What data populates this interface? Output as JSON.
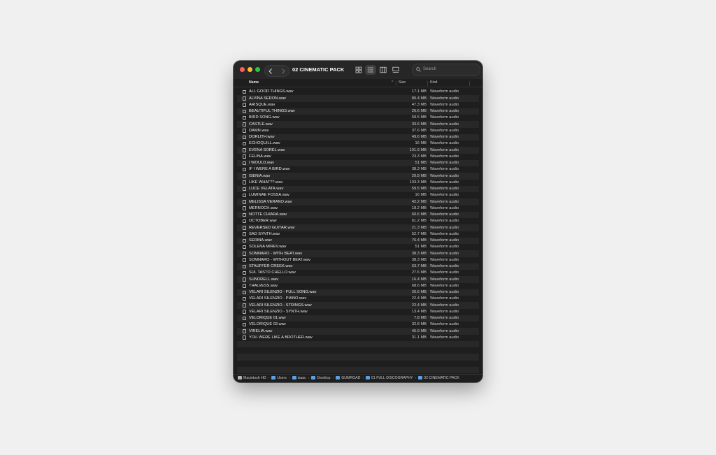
{
  "window": {
    "title": "02 CINEMATIC PACK",
    "search_placeholder": "Search"
  },
  "toolbar": {
    "back_icon": "chevron-left-icon",
    "forward_icon": "chevron-right-icon",
    "view_icons": [
      "icon-view-icon",
      "list-view-icon",
      "column-view-icon",
      "gallery-view-icon"
    ],
    "active_view": "list-view-icon"
  },
  "columns": {
    "name": "Name",
    "size": "Size",
    "kind": "Kind"
  },
  "files": [
    {
      "name": "ALL GOOD THINGS.wav",
      "size": "17.1 MB",
      "kind": "Waveform audio"
    },
    {
      "name": "ALVINA SERON.wav",
      "size": "80.4 MB",
      "kind": "Waveform audio"
    },
    {
      "name": "ARISQUE.wav",
      "size": "47.3 MB",
      "kind": "Waveform audio"
    },
    {
      "name": "BEAUTIFUL THINGS.wav",
      "size": "26.6 MB",
      "kind": "Waveform audio"
    },
    {
      "name": "BIRD SONG.wav",
      "size": "59.5 MB",
      "kind": "Waveform audio"
    },
    {
      "name": "CASTLE.wav",
      "size": "33.6 MB",
      "kind": "Waveform audio"
    },
    {
      "name": "DAMN.wav",
      "size": "37.6 MB",
      "kind": "Waveform audio"
    },
    {
      "name": "DORLITH.wav",
      "size": "49.6 MB",
      "kind": "Waveform audio"
    },
    {
      "name": "ECHOQUILL.wav",
      "size": "16 MB",
      "kind": "Waveform audio"
    },
    {
      "name": "EVENA SOREL.wav",
      "size": "101.9 MB",
      "kind": "Waveform audio"
    },
    {
      "name": "FELINA.wav",
      "size": "23.3 MB",
      "kind": "Waveform audio"
    },
    {
      "name": "I WOULD.wav",
      "size": "51 MB",
      "kind": "Waveform audio"
    },
    {
      "name": "IF I WERE A BIRD.wav",
      "size": "38.3 MB",
      "kind": "Waveform audio"
    },
    {
      "name": "ISENIA.wav",
      "size": "20.8 MB",
      "kind": "Waveform audio"
    },
    {
      "name": "LIKE WHAT??.wav",
      "size": "103.3 MB",
      "kind": "Waveform audio"
    },
    {
      "name": "LUCE VELATA.wav",
      "size": "59.5 MB",
      "kind": "Waveform audio"
    },
    {
      "name": "LUMINAE FOSSA.wav",
      "size": "16 MB",
      "kind": "Waveform audio"
    },
    {
      "name": "MELISSA VERANO.wav",
      "size": "42.2 MB",
      "kind": "Waveform audio"
    },
    {
      "name": "MERNOCH.wav",
      "size": "18.2 MB",
      "kind": "Waveform audio"
    },
    {
      "name": "NOTTE CHIARA.wav",
      "size": "60.6 MB",
      "kind": "Waveform audio"
    },
    {
      "name": "OCTOBER.wav",
      "size": "61.2 MB",
      "kind": "Waveform audio"
    },
    {
      "name": "REVERSED GUITAR.wav",
      "size": "21.3 MB",
      "kind": "Waveform audio"
    },
    {
      "name": "SAD SYNTH.wav",
      "size": "52.7 MB",
      "kind": "Waveform audio"
    },
    {
      "name": "SERINA.wav",
      "size": "76.4 MB",
      "kind": "Waveform audio"
    },
    {
      "name": "SOLENA MIREV.wav",
      "size": "51 MB",
      "kind": "Waveform audio"
    },
    {
      "name": "SOMNARO - WITH BEAT.wav",
      "size": "38.3 MB",
      "kind": "Waveform audio"
    },
    {
      "name": "SOMNARO - WITHOUT BEAT.wav",
      "size": "38.3 MB",
      "kind": "Waveform audio"
    },
    {
      "name": "STAUFFER CREEK.wav",
      "size": "63.7 MB",
      "kind": "Waveform audio"
    },
    {
      "name": "SUL TASTO CHELLO.wav",
      "size": "27.6 MB",
      "kind": "Waveform audio"
    },
    {
      "name": "SUNDRELL.wav",
      "size": "16.4 MB",
      "kind": "Waveform audio"
    },
    {
      "name": "THALVESS.wav",
      "size": "68.6 MB",
      "kind": "Waveform audio"
    },
    {
      "name": "VELARI SILENZIO - FULL SONG.wav",
      "size": "26.6 MB",
      "kind": "Waveform audio"
    },
    {
      "name": "VELARI SILENZIO - PIANO.wav",
      "size": "22.4 MB",
      "kind": "Waveform audio"
    },
    {
      "name": "VELARI SILENZIO - STRINGS.wav",
      "size": "22.4 MB",
      "kind": "Waveform audio"
    },
    {
      "name": "VELARI SILENZIO - SYNTH.wav",
      "size": "13.4 MB",
      "kind": "Waveform audio"
    },
    {
      "name": "VELORIQUE 01.wav",
      "size": "7.8 MB",
      "kind": "Waveform audio"
    },
    {
      "name": "VELORIQUE 02.wav",
      "size": "32.8 MB",
      "kind": "Waveform audio"
    },
    {
      "name": "VIRELIA.wav",
      "size": "45.9 MB",
      "kind": "Waveform audio"
    },
    {
      "name": "YOU WERE LIKE A BROTHER.wav",
      "size": "31.1 MB",
      "kind": "Waveform audio"
    }
  ],
  "path": [
    {
      "label": "Macintosh HD",
      "icon": "disk-icon"
    },
    {
      "label": "Users",
      "icon": "folder-icon"
    },
    {
      "label": "isaac",
      "icon": "folder-icon"
    },
    {
      "label": "Desktop",
      "icon": "folder-icon"
    },
    {
      "label": "GUMROAD",
      "icon": "folder-icon"
    },
    {
      "label": "01 FULL DISCOGRAPHY",
      "icon": "folder-icon"
    },
    {
      "label": "02 CINEMATIC PACK",
      "icon": "folder-icon"
    }
  ],
  "colors": {
    "close": "#ff5f57",
    "minimize": "#febc2e",
    "zoom": "#28c840",
    "folder": "#5aa0e6"
  }
}
